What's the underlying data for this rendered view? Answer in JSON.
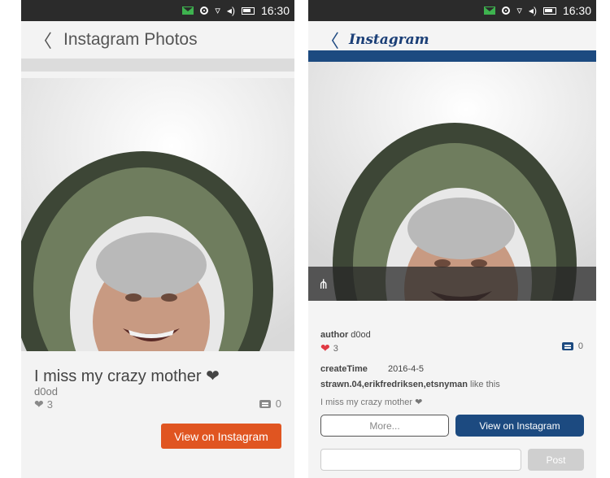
{
  "status_bar": {
    "time": "16:30",
    "icons": [
      "mail-icon",
      "location-icon",
      "wifi-icon",
      "volume-icon",
      "battery-icon"
    ]
  },
  "left": {
    "header": {
      "back": "〈",
      "title": "Instagram Photos"
    },
    "post": {
      "caption": "I miss my crazy mother ❤",
      "author": "d0od",
      "likes": "3",
      "comments": "0"
    },
    "buttons": {
      "view": "View on Instagram"
    },
    "colors": {
      "accent": "#e05521",
      "icon": "#888888"
    }
  },
  "right": {
    "header": {
      "back": "〈",
      "title": "Instagram"
    },
    "post": {
      "author_label": "author",
      "author": "d0od",
      "likes": "3",
      "comments": "0",
      "create_time_label": "createTime",
      "create_time": "2016-4-5",
      "liked_by": "strawn.04,erikfredriksen,etsnyman",
      "liked_suffix": "like this",
      "caption": "I miss my crazy mother ❤"
    },
    "buttons": {
      "more": "More...",
      "view": "View on Instagram",
      "post": "Post"
    },
    "colors": {
      "brand": "#1c4a80",
      "heart": "#e03a44"
    }
  }
}
